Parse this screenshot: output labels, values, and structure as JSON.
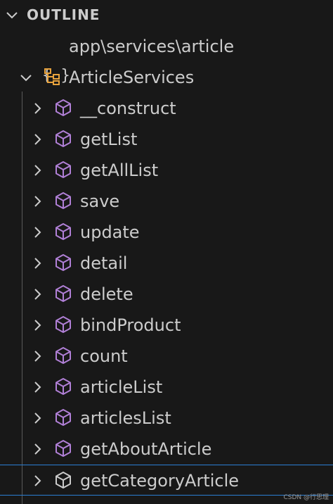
{
  "header": {
    "title": "OUTLINE",
    "chevron_icon": "chevron-down-icon"
  },
  "namespace": {
    "icon": "{ }",
    "label": "app\\services\\article"
  },
  "class": {
    "label": "ArticleServices",
    "icon": "class-icon",
    "icon_color": "#e8a33d"
  },
  "methods": [
    {
      "label": "__construct"
    },
    {
      "label": "getList"
    },
    {
      "label": "getAllList"
    },
    {
      "label": "save"
    },
    {
      "label": "update"
    },
    {
      "label": "detail"
    },
    {
      "label": "delete"
    },
    {
      "label": "bindProduct"
    },
    {
      "label": "count"
    },
    {
      "label": "articleList"
    },
    {
      "label": "articlesList"
    },
    {
      "label": "getAboutArticle"
    },
    {
      "label": "getCategoryArticle"
    }
  ],
  "colors": {
    "background": "#181818",
    "method_icon": "#b180d7",
    "selected_icon": "#cccccc",
    "selection_border": "#2b7fd4"
  },
  "watermark": "CSDN @行思理"
}
